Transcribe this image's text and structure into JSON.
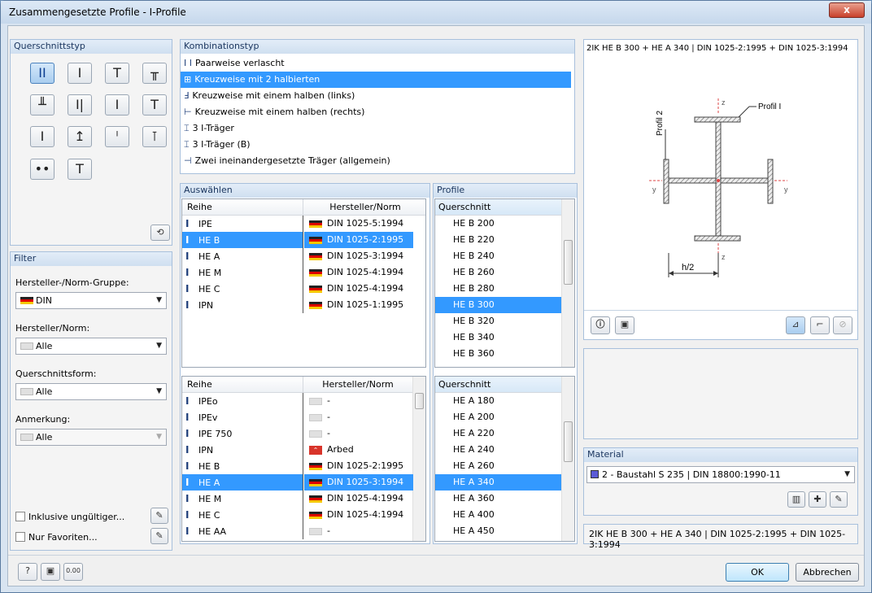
{
  "window": {
    "title": "Zusammengesetzte Profile - I-Profile",
    "close_label": "x"
  },
  "querschnittstyp": {
    "title": "Querschnittstyp"
  },
  "filter": {
    "title": "Filter",
    "group_label": "Hersteller-/Norm-Gruppe:",
    "group_value": "DIN",
    "norm_label": "Hersteller/Norm:",
    "norm_value": "Alle",
    "form_label": "Querschnittsform:",
    "form_value": "Alle",
    "remark_label": "Anmerkung:",
    "remark_value": "Alle",
    "invalid_label": "Inklusive ungültiger...",
    "fav_label": "Nur Favoriten..."
  },
  "kombination": {
    "title": "Kombinationstyp",
    "items": [
      {
        "icon": "I I",
        "label": "Paarweise verlascht"
      },
      {
        "icon": "⊞",
        "label": "Kreuzweise mit 2 halbierten"
      },
      {
        "icon": "Ⅎ",
        "label": "Kreuzweise mit einem halben (links)"
      },
      {
        "icon": "⊢",
        "label": "Kreuzweise mit einem halben (rechts)"
      },
      {
        "icon": "⌶",
        "label": "3 I-Träger"
      },
      {
        "icon": "⌶",
        "label": "3 I-Träger (B)"
      },
      {
        "icon": "⊣",
        "label": "Zwei ineinandergesetzte Träger (allgemein)"
      }
    ],
    "selected": 1
  },
  "auswaehlen": {
    "title": "Auswählen",
    "col_reihe": "Reihe",
    "col_norm": "Hersteller/Norm",
    "rows1": [
      {
        "reihe": "IPE",
        "norm": "DIN 1025-5:1994",
        "flag": "din"
      },
      {
        "reihe": "HE B",
        "norm": "DIN 1025-2:1995",
        "flag": "din"
      },
      {
        "reihe": "HE A",
        "norm": "DIN 1025-3:1994",
        "flag": "din"
      },
      {
        "reihe": "HE M",
        "norm": "DIN 1025-4:1994",
        "flag": "din"
      },
      {
        "reihe": "HE C",
        "norm": "DIN 1025-4:1994",
        "flag": "din"
      },
      {
        "reihe": "IPN",
        "norm": "DIN 1025-1:1995",
        "flag": "din"
      }
    ],
    "rows2": [
      {
        "reihe": "IPEo",
        "norm": "-",
        "flag": "none"
      },
      {
        "reihe": "IPEv",
        "norm": "-",
        "flag": "none"
      },
      {
        "reihe": "IPE 750",
        "norm": "-",
        "flag": "none"
      },
      {
        "reihe": "IPN",
        "norm": "Arbed",
        "flag": "arbed"
      },
      {
        "reihe": "HE B",
        "norm": "DIN 1025-2:1995",
        "flag": "din"
      },
      {
        "reihe": "HE A",
        "norm": "DIN 1025-3:1994",
        "flag": "din"
      },
      {
        "reihe": "HE M",
        "norm": "DIN 1025-4:1994",
        "flag": "din"
      },
      {
        "reihe": "HE C",
        "norm": "DIN 1025-4:1994",
        "flag": "din"
      },
      {
        "reihe": "HE AA",
        "norm": "-",
        "flag": "none"
      }
    ]
  },
  "profile": {
    "title": "Profile",
    "col": "Querschnitt",
    "list1": [
      "HE B 200",
      "HE B 220",
      "HE B 240",
      "HE B 260",
      "HE B 280",
      "HE B 300",
      "HE B 320",
      "HE B 340",
      "HE B 360"
    ],
    "list2": [
      "HE A 180",
      "HE A 200",
      "HE A 220",
      "HE A 240",
      "HE A 260",
      "HE A 340",
      "HE A 360",
      "HE A 400",
      "HE A 450"
    ]
  },
  "preview": {
    "title": "2IK HE B 300 + HE A 340 | DIN 1025-2:1995 + DIN 1025-3:1994",
    "label_profil1": "Profil I",
    "label_profil2": "Profil 2",
    "label_h2": "h/2",
    "axis_z": "z",
    "axis_y": "y"
  },
  "material": {
    "title": "Material",
    "value": "2 - Baustahl S 235 | DIN 18800:1990-11",
    "color": "#5b5bd6"
  },
  "result": "2IK HE B 300 + HE A 340 | DIN 1025-2:1995 + DIN 1025-3:1994",
  "buttons": {
    "ok": "OK",
    "cancel": "Abbrechen"
  }
}
